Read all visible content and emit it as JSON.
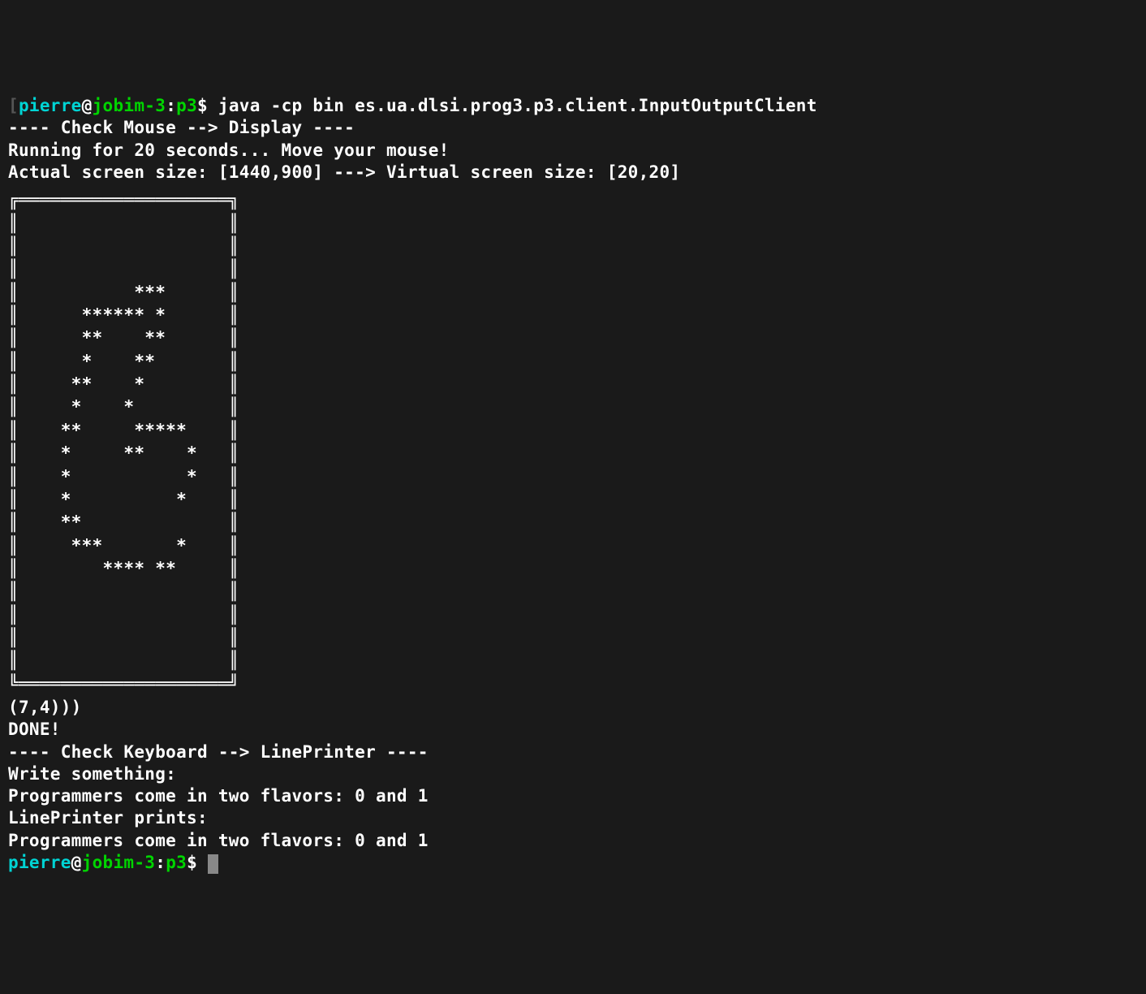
{
  "prompt1": {
    "bracket_open": "[",
    "user": "pierre",
    "at": "@",
    "host": "jobim-3",
    "colon": ":",
    "path": "p3",
    "dollar": "$ ",
    "command": "java -cp bin es.ua.dlsi.prog3.p3.client.InputOutputClient"
  },
  "lines": {
    "l1": "---- Check Mouse --> Display ----",
    "l2": "Running for 20 seconds... Move your mouse!",
    "l3": "Actual screen size: [1440,900] ---> Virtual screen size: [20,20]"
  },
  "box": {
    "top": "╔════════════════════╗",
    "r1": "║                    ║",
    "r2": "║                    ║",
    "r3": "║                    ║",
    "r4": "║           ***      ║",
    "r5": "║      ****** *      ║",
    "r6": "║      **    **      ║",
    "r7": "║      *    **       ║",
    "r8": "║     **    *        ║",
    "r9": "║     *    *         ║",
    "r10": "║    **     *****    ║",
    "r11": "║    *     **    *   ║",
    "r12": "║    *           *   ║",
    "r13": "║    *          *    ║",
    "r14": "║    **              ║",
    "r15": "║     ***       *    ║",
    "r16": "║        **** **     ║",
    "r17": "║                    ║",
    "r18": "║                    ║",
    "r19": "║                    ║",
    "r20": "║                    ║",
    "bottom": "╚════════════════════╝"
  },
  "after": {
    "coord": "(7,4)))",
    "done": "DONE!",
    "kb_header": "---- Check Keyboard --> LinePrinter ----",
    "write": "Write something:",
    "input_text": "Programmers come in two flavors: 0 and 1",
    "lp": "LinePrinter prints:",
    "output_text": "Programmers come in two flavors: 0 and 1"
  },
  "prompt2": {
    "user": "pierre",
    "at": "@",
    "host": "jobim-3",
    "colon": ":",
    "path": "p3",
    "dollar": "$ "
  }
}
